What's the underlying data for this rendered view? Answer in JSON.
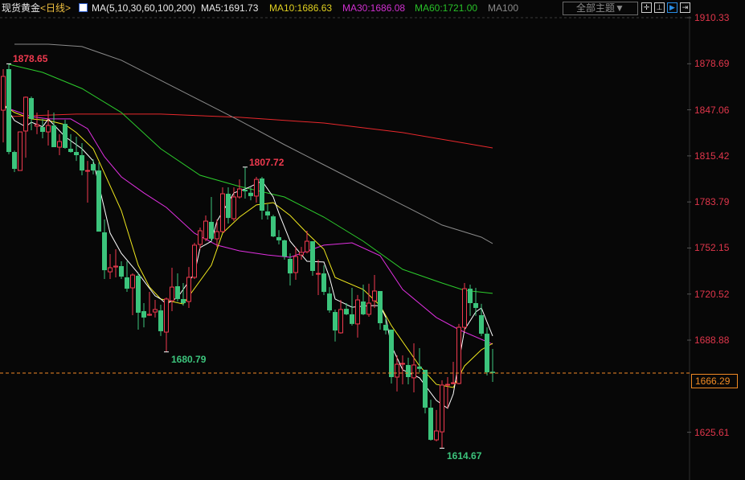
{
  "header": {
    "symbol": "现货黄金",
    "period": "<日线>",
    "ma_params": "MA(5,10,30,60,100,200)",
    "ma5": "MA5:1691.73",
    "ma10": "MA10:1686.63",
    "ma30": "MA30:1686.08",
    "ma60": "MA60:1721.00",
    "ma100": "MA100",
    "theme_button": "全部主题▼"
  },
  "colors": {
    "up": "#f03a4f",
    "down": "#3cc47c",
    "ma5": "#ffffff",
    "ma10": "#f0e81e",
    "ma30": "#e030e0",
    "ma60": "#2ccc2c",
    "ma100": "#8a8a8a",
    "ma200": "#e8282c",
    "axis": "#e0364b",
    "last": "#f08a24"
  },
  "chart_data": {
    "type": "candlestick",
    "title": "现货黄金 日线",
    "ylim": [
      1610,
      1922
    ],
    "y_ticks": [
      "1910.33",
      "1878.69",
      "1847.06",
      "1815.42",
      "1783.79",
      "1752.15",
      "1720.52",
      "1688.88",
      "1625.61"
    ],
    "last_price": "1666.29",
    "annotations": {
      "high1": "1878.65",
      "low1": "1680.79",
      "high2": "1807.72",
      "low2": "1614.67"
    },
    "candles": [
      [
        1846.8,
        1875.0,
        1824.7,
        1870.0
      ],
      [
        1875.0,
        1878.65,
        1816.5,
        1818.1
      ],
      [
        1818.1,
        1819.0,
        1804.3,
        1806.5
      ],
      [
        1805.4,
        1832.0,
        1805.4,
        1831.9
      ],
      [
        1832.5,
        1856.2,
        1814.2,
        1855.7
      ],
      [
        1855.1,
        1856.2,
        1833.0,
        1840.8
      ],
      [
        1835.8,
        1845.2,
        1830.3,
        1836.9
      ],
      [
        1835.2,
        1840.8,
        1827.5,
        1831.9
      ],
      [
        1831.9,
        1846.8,
        1822.5,
        1836.3
      ],
      [
        1836.3,
        1845.2,
        1821.4,
        1821.4
      ],
      [
        1821.4,
        1830.3,
        1815.9,
        1825.3
      ],
      [
        1837.4,
        1840.2,
        1820.3,
        1820.9
      ],
      [
        1820.3,
        1830.3,
        1817.6,
        1818.1
      ],
      [
        1818.1,
        1828.6,
        1812.0,
        1815.9
      ],
      [
        1815.9,
        1824.2,
        1802.1,
        1805.4
      ],
      [
        1804.9,
        1812.0,
        1783.3,
        1805.4
      ],
      [
        1809.8,
        1813.1,
        1802.7,
        1805.4
      ],
      [
        1805.4,
        1810.9,
        1763.4,
        1763.4
      ],
      [
        1762.9,
        1771.7,
        1730.9,
        1736.9
      ],
      [
        1735.8,
        1748.0,
        1730.9,
        1738.6
      ],
      [
        1739.1,
        1751.3,
        1732.0,
        1739.7
      ],
      [
        1739.7,
        1743.0,
        1730.9,
        1732.5
      ],
      [
        1732.0,
        1743.0,
        1722.0,
        1724.2
      ],
      [
        1724.8,
        1734.7,
        1706.0,
        1733.6
      ],
      [
        1733.1,
        1734.7,
        1696.1,
        1707.7
      ],
      [
        1708.8,
        1714.3,
        1697.7,
        1704.4
      ],
      [
        1706.0,
        1722.0,
        1705.5,
        1706.6
      ],
      [
        1708.2,
        1716.5,
        1704.4,
        1709.9
      ],
      [
        1709.3,
        1713.2,
        1691.7,
        1695.0
      ],
      [
        1694.4,
        1718.2,
        1680.79,
        1717.1
      ],
      [
        1715.9,
        1738.6,
        1708.8,
        1725.3
      ],
      [
        1725.9,
        1734.7,
        1715.4,
        1717.1
      ],
      [
        1717.1,
        1728.1,
        1712.6,
        1714.3
      ],
      [
        1715.4,
        1739.1,
        1711.0,
        1732.0
      ],
      [
        1732.0,
        1755.7,
        1730.9,
        1754.1
      ],
      [
        1754.6,
        1766.2,
        1751.3,
        1764.0
      ],
      [
        1758.5,
        1774.5,
        1756.8,
        1770.6
      ],
      [
        1770.1,
        1787.2,
        1756.8,
        1758.5
      ],
      [
        1758.5,
        1771.7,
        1752.9,
        1763.4
      ],
      [
        1763.4,
        1793.8,
        1762.9,
        1789.4
      ],
      [
        1789.4,
        1793.8,
        1769.0,
        1772.8
      ],
      [
        1772.3,
        1793.8,
        1770.6,
        1787.2
      ],
      [
        1787.2,
        1799.3,
        1786.1,
        1792.7
      ],
      [
        1792.2,
        1807.72,
        1786.1,
        1791.1
      ],
      [
        1790.1,
        1793.8,
        1784.9,
        1787.8
      ],
      [
        1787.8,
        1801.0,
        1783.3,
        1799.3
      ],
      [
        1799.9,
        1801.0,
        1771.7,
        1777.8
      ],
      [
        1777.3,
        1782.2,
        1771.7,
        1774.5
      ],
      [
        1773.9,
        1775.0,
        1759.6,
        1760.1
      ],
      [
        1759.6,
        1764.5,
        1754.6,
        1757.4
      ],
      [
        1757.4,
        1757.9,
        1744.1,
        1746.3
      ],
      [
        1744.7,
        1748.5,
        1726.4,
        1734.7
      ],
      [
        1735.3,
        1752.9,
        1730.3,
        1746.3
      ],
      [
        1747.4,
        1752.9,
        1744.1,
        1749.1
      ],
      [
        1749.6,
        1764.0,
        1748.5,
        1756.8
      ],
      [
        1756.8,
        1756.8,
        1733.1,
        1736.4
      ],
      [
        1734.2,
        1744.1,
        1719.8,
        1734.7
      ],
      [
        1734.7,
        1740.3,
        1719.8,
        1722.0
      ],
      [
        1720.9,
        1725.3,
        1707.7,
        1709.3
      ],
      [
        1708.2,
        1709.9,
        1687.9,
        1695.5
      ],
      [
        1693.9,
        1716.5,
        1693.3,
        1709.9
      ],
      [
        1710.4,
        1714.3,
        1706.0,
        1706.6
      ],
      [
        1706.6,
        1724.8,
        1698.9,
        1700.0
      ],
      [
        1700.0,
        1719.9,
        1690.6,
        1716.5
      ],
      [
        1715.4,
        1727.0,
        1706.0,
        1706.6
      ],
      [
        1706.6,
        1727.6,
        1704.9,
        1714.3
      ],
      [
        1715.9,
        1733.6,
        1711.0,
        1722.6
      ],
      [
        1722.6,
        1722.6,
        1696.1,
        1700.5
      ],
      [
        1699.4,
        1704.4,
        1692.8,
        1695.5
      ],
      [
        1696.1,
        1696.1,
        1659.1,
        1663.5
      ],
      [
        1663.5,
        1678.4,
        1653.6,
        1672.3
      ],
      [
        1672.4,
        1678.4,
        1658.5,
        1672.9
      ],
      [
        1671.8,
        1676.8,
        1658.5,
        1663.5
      ],
      [
        1663.0,
        1686.7,
        1653.0,
        1671.8
      ],
      [
        1670.7,
        1683.4,
        1666.8,
        1669.1
      ],
      [
        1668.5,
        1668.5,
        1638.6,
        1642.5
      ],
      [
        1642.5,
        1648.0,
        1619.9,
        1620.4
      ],
      [
        1620.4,
        1640.9,
        1619.3,
        1626.5
      ],
      [
        1625.9,
        1661.3,
        1614.67,
        1658.0
      ],
      [
        1658.2,
        1663.5,
        1642.0,
        1658.5
      ],
      [
        1659.1,
        1674.0,
        1658.5,
        1659.6
      ],
      [
        1659.1,
        1700.0,
        1658.5,
        1697.7
      ],
      [
        1697.7,
        1728.1,
        1694.4,
        1724.2
      ],
      [
        1724.2,
        1727.0,
        1705.5,
        1714.3
      ],
      [
        1714.3,
        1724.8,
        1705.5,
        1711.0
      ],
      [
        1706.0,
        1713.8,
        1691.7,
        1693.3
      ],
      [
        1693.3,
        1697.7,
        1664.6,
        1666.8
      ],
      [
        1667.2,
        1682.8,
        1660.2,
        1666.29
      ]
    ],
    "candle_fields": [
      "open",
      "high",
      "low",
      "close"
    ],
    "series": [
      {
        "name": "MA200",
        "color_key": "ma200",
        "points": [
          [
            1,
            1842.4
          ],
          [
            13,
            1844.1
          ],
          [
            28,
            1844.1
          ],
          [
            42,
            1841.9
          ],
          [
            57,
            1838.0
          ],
          [
            71,
            1831.4
          ],
          [
            82,
            1824.2
          ],
          [
            87,
            1820.9
          ]
        ]
      },
      {
        "name": "MA100",
        "color_key": "ma100",
        "points": [
          [
            2,
            1892.1
          ],
          [
            8,
            1892.1
          ],
          [
            14,
            1890.5
          ],
          [
            21,
            1881.1
          ],
          [
            28,
            1867.3
          ],
          [
            35,
            1853.5
          ],
          [
            42,
            1839.7
          ],
          [
            50,
            1823.1
          ],
          [
            57,
            1809.3
          ],
          [
            64,
            1795.5
          ],
          [
            71,
            1781.7
          ],
          [
            78,
            1767.9
          ],
          [
            85,
            1759.6
          ],
          [
            87,
            1755.2
          ]
        ]
      },
      {
        "name": "MA60",
        "color_key": "ma60",
        "points": [
          [
            1,
            1878.3
          ],
          [
            7,
            1872.8
          ],
          [
            14,
            1861.7
          ],
          [
            21,
            1845.2
          ],
          [
            28,
            1820.3
          ],
          [
            35,
            1802.1
          ],
          [
            42,
            1794.4
          ],
          [
            50,
            1787.2
          ],
          [
            57,
            1773.4
          ],
          [
            64,
            1756.8
          ],
          [
            71,
            1737.5
          ],
          [
            78,
            1728.1
          ],
          [
            82,
            1723.1
          ],
          [
            87,
            1721.0
          ]
        ]
      },
      {
        "name": "MA30",
        "color_key": "ma30",
        "points": [
          [
            1,
            1847.9
          ],
          [
            5,
            1842.4
          ],
          [
            8,
            1840.8
          ],
          [
            12,
            1840.8
          ],
          [
            15,
            1834.1
          ],
          [
            18,
            1814.8
          ],
          [
            21,
            1801.0
          ],
          [
            25,
            1790.0
          ],
          [
            29,
            1780.0
          ],
          [
            34,
            1762.3
          ],
          [
            38,
            1754.1
          ],
          [
            42,
            1750.2
          ],
          [
            47,
            1747.4
          ],
          [
            51,
            1745.8
          ],
          [
            57,
            1754.1
          ],
          [
            62,
            1755.7
          ],
          [
            67,
            1746.9
          ],
          [
            71,
            1723.7
          ],
          [
            77,
            1704.4
          ],
          [
            81,
            1696.1
          ],
          [
            87,
            1686.08
          ]
        ]
      },
      {
        "name": "MA10",
        "color_key": "ma10",
        "points": [
          [
            0,
            1850.7
          ],
          [
            2,
            1845.2
          ],
          [
            5,
            1840.8
          ],
          [
            8,
            1839.7
          ],
          [
            11,
            1836.9
          ],
          [
            13,
            1831.4
          ],
          [
            16,
            1820.3
          ],
          [
            17,
            1812.0
          ],
          [
            21,
            1777.8
          ],
          [
            24,
            1740.3
          ],
          [
            26,
            1725.3
          ],
          [
            28,
            1717.1
          ],
          [
            32,
            1713.7
          ],
          [
            37,
            1740.3
          ],
          [
            39,
            1762.4
          ],
          [
            42,
            1773.4
          ],
          [
            45,
            1781.7
          ],
          [
            48,
            1783.3
          ],
          [
            51,
            1774.5
          ],
          [
            54,
            1762.4
          ],
          [
            57,
            1751.3
          ],
          [
            59,
            1731.9
          ],
          [
            64,
            1723.7
          ],
          [
            67,
            1712.6
          ],
          [
            69,
            1698.9
          ],
          [
            74,
            1671.2
          ],
          [
            77,
            1658.5
          ],
          [
            80,
            1656.3
          ],
          [
            82,
            1671.2
          ],
          [
            85,
            1682.3
          ],
          [
            87,
            1686.63
          ]
        ]
      },
      {
        "name": "MA5",
        "color_key": "ma5",
        "points": [
          [
            0,
            1851.8
          ],
          [
            2,
            1839.7
          ],
          [
            4,
            1835.4
          ],
          [
            5,
            1838.6
          ],
          [
            7,
            1835.4
          ],
          [
            8,
            1840.8
          ],
          [
            11,
            1828.6
          ],
          [
            14,
            1820.3
          ],
          [
            16,
            1812.0
          ],
          [
            17,
            1795.5
          ],
          [
            19,
            1762.4
          ],
          [
            21,
            1748.5
          ],
          [
            24,
            1734.7
          ],
          [
            27,
            1719.3
          ],
          [
            28,
            1717.1
          ],
          [
            29,
            1713.7
          ],
          [
            31,
            1718.2
          ],
          [
            34,
            1734.7
          ],
          [
            35,
            1752.4
          ],
          [
            37,
            1756.8
          ],
          [
            38,
            1770.6
          ],
          [
            41,
            1790.0
          ],
          [
            43,
            1792.7
          ],
          [
            44,
            1794.4
          ],
          [
            46,
            1798.2
          ],
          [
            48,
            1787.2
          ],
          [
            49,
            1776.1
          ],
          [
            51,
            1756.8
          ],
          [
            54,
            1743.0
          ],
          [
            57,
            1742.5
          ],
          [
            58,
            1732.0
          ],
          [
            59,
            1717.1
          ],
          [
            62,
            1711.5
          ],
          [
            65,
            1712.6
          ],
          [
            67,
            1712.6
          ],
          [
            68,
            1704.4
          ],
          [
            69,
            1685.0
          ],
          [
            71,
            1668.5
          ],
          [
            74,
            1663.0
          ],
          [
            77,
            1647.5
          ],
          [
            79,
            1642.0
          ],
          [
            80,
            1651.9
          ],
          [
            82,
            1696.1
          ],
          [
            84,
            1708.2
          ],
          [
            85,
            1711.0
          ],
          [
            87,
            1691.73
          ]
        ]
      }
    ]
  }
}
